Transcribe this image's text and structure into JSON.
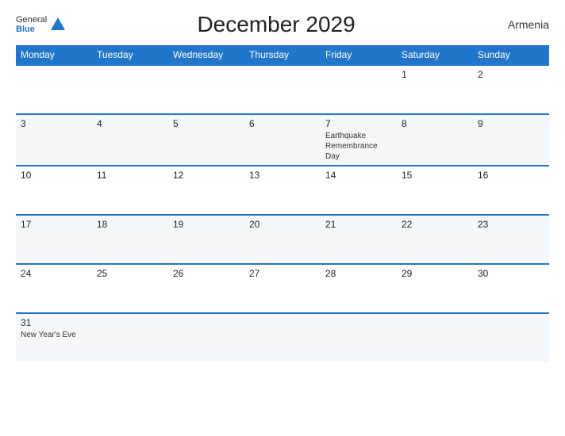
{
  "logo": {
    "general": "General",
    "blue": "Blue"
  },
  "title": "December 2029",
  "country": "Armenia",
  "days_header": [
    "Monday",
    "Tuesday",
    "Wednesday",
    "Thursday",
    "Friday",
    "Saturday",
    "Sunday"
  ],
  "weeks": [
    [
      {
        "day": "",
        "event": ""
      },
      {
        "day": "",
        "event": ""
      },
      {
        "day": "",
        "event": ""
      },
      {
        "day": "",
        "event": ""
      },
      {
        "day": "",
        "event": ""
      },
      {
        "day": "1",
        "event": ""
      },
      {
        "day": "2",
        "event": ""
      }
    ],
    [
      {
        "day": "3",
        "event": ""
      },
      {
        "day": "4",
        "event": ""
      },
      {
        "day": "5",
        "event": ""
      },
      {
        "day": "6",
        "event": ""
      },
      {
        "day": "7",
        "event": "Earthquake Remembrance Day"
      },
      {
        "day": "8",
        "event": ""
      },
      {
        "day": "9",
        "event": ""
      }
    ],
    [
      {
        "day": "10",
        "event": ""
      },
      {
        "day": "11",
        "event": ""
      },
      {
        "day": "12",
        "event": ""
      },
      {
        "day": "13",
        "event": ""
      },
      {
        "day": "14",
        "event": ""
      },
      {
        "day": "15",
        "event": ""
      },
      {
        "day": "16",
        "event": ""
      }
    ],
    [
      {
        "day": "17",
        "event": ""
      },
      {
        "day": "18",
        "event": ""
      },
      {
        "day": "19",
        "event": ""
      },
      {
        "day": "20",
        "event": ""
      },
      {
        "day": "21",
        "event": ""
      },
      {
        "day": "22",
        "event": ""
      },
      {
        "day": "23",
        "event": ""
      }
    ],
    [
      {
        "day": "24",
        "event": ""
      },
      {
        "day": "25",
        "event": ""
      },
      {
        "day": "26",
        "event": ""
      },
      {
        "day": "27",
        "event": ""
      },
      {
        "day": "28",
        "event": ""
      },
      {
        "day": "29",
        "event": ""
      },
      {
        "day": "30",
        "event": ""
      }
    ],
    [
      {
        "day": "31",
        "event": "New Year's Eve"
      },
      {
        "day": "",
        "event": ""
      },
      {
        "day": "",
        "event": ""
      },
      {
        "day": "",
        "event": ""
      },
      {
        "day": "",
        "event": ""
      },
      {
        "day": "",
        "event": ""
      },
      {
        "day": "",
        "event": ""
      }
    ]
  ]
}
